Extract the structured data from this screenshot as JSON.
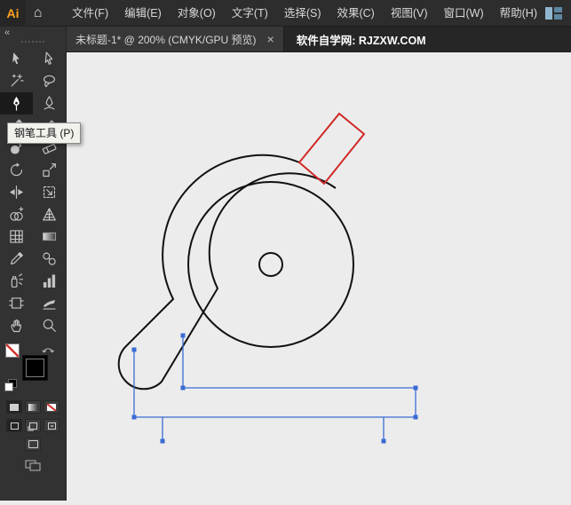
{
  "app": {
    "logo_text": "Ai"
  },
  "menubar": {
    "items": [
      "文件(F)",
      "编辑(E)",
      "对象(O)",
      "文字(T)",
      "选择(S)",
      "效果(C)",
      "视图(V)",
      "窗口(W)",
      "帮助(H)"
    ]
  },
  "tabbar": {
    "title": "未标题-1* @ 200% (CMYK/GPU 预览)",
    "site_label": "软件自学网: RJZXW.COM"
  },
  "toolbar": {
    "active_tool": "pen",
    "tools": [
      "selection",
      "direct-selection",
      "magic-wand",
      "lasso",
      "pen",
      "curvature",
      "paintbrush",
      "pencil",
      "blob-brush",
      "eraser",
      "rotate",
      "scale",
      "width",
      "free-transform",
      "shape-builder",
      "perspective-grid",
      "mesh",
      "gradient",
      "eyedropper",
      "blend",
      "symbol-sprayer",
      "column-graph",
      "artboard",
      "slice",
      "hand",
      "zoom"
    ],
    "fill_swatch": "none",
    "stroke_swatch": "black"
  },
  "tooltip": {
    "text": "钢笔工具 (P)"
  },
  "zoom_level": "200%",
  "colors": {
    "outline_black": "#111111",
    "accent_red": "#cf2a27",
    "selection_blue": "#3a6bd4",
    "logo_orange": "#ffa21f",
    "canvas_bg": "#ececec"
  },
  "icons": {
    "home-icon": "⌂",
    "close-icon": "×",
    "collapse-icon": "«"
  }
}
